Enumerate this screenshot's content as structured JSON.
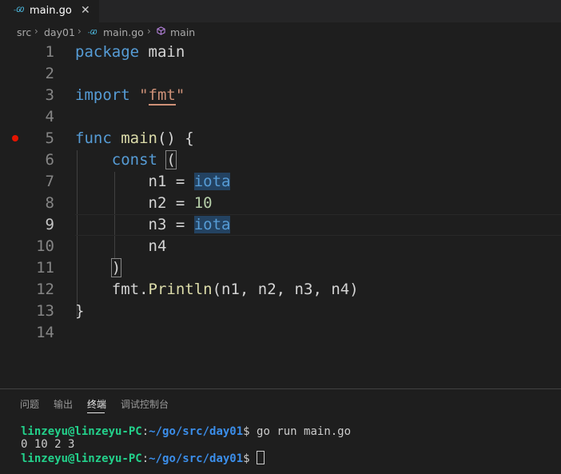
{
  "tab": {
    "icon": "go-file-icon",
    "filename": "main.go",
    "close_glyph": "✕"
  },
  "breadcrumb": {
    "items": [
      "src",
      "day01",
      "main.go",
      "main"
    ],
    "separator": "›"
  },
  "editor": {
    "line_numbers": [
      "1",
      "2",
      "3",
      "4",
      "5",
      "6",
      "7",
      "8",
      "9",
      "10",
      "11",
      "12",
      "13",
      "14"
    ],
    "active_line": "9",
    "breakpoint_line": "5",
    "tokens": {
      "l1_kw": "package",
      "l1_id": " main",
      "l3_kw": "import",
      "l3_q1": " \"",
      "l3_str": "fmt",
      "l3_q2": "\"",
      "l5_kw": "func",
      "l5_fn": " main",
      "l5_rest": "() {",
      "l6_indent": "    ",
      "l6_kw": "const",
      "l6_sp": " ",
      "l6_paren": "(",
      "l7_indent": "        ",
      "l7_id": "n1 = ",
      "l7_iota": "iota",
      "l8_indent": "        ",
      "l8_id": "n2 = ",
      "l8_num": "10",
      "l9_indent": "        ",
      "l9_id": "n3 = ",
      "l9_iota": "iota",
      "l10_indent": "        ",
      "l10_id": "n4",
      "l11_indent": "    ",
      "l11_paren": ")",
      "l12_indent": "    ",
      "l12_pkg": "fmt.",
      "l12_fn": "Println",
      "l12_args": "(n1, n2, n3, n4)",
      "l13_brace": "}"
    }
  },
  "panel": {
    "tabs": [
      "问题",
      "输出",
      "终端",
      "调试控制台"
    ],
    "active_tab": "终端",
    "terminal": {
      "user_host": "linzeyu@linzeyu-PC",
      "colon": ":",
      "path": "~/go/src/day01",
      "prompt": "$ ",
      "command": "go run main.go",
      "output": "0 10 2 3",
      "user_host2": "linzeyu@linzeyu-PC",
      "path2": "~/go/src/day01",
      "prompt2": "$ "
    }
  },
  "colors": {
    "keyword": "#569cd6",
    "function": "#dcdcaa",
    "string": "#ce9178",
    "number": "#b5cea8",
    "terminal_user": "#23d18b",
    "terminal_path": "#3b8eea",
    "breakpoint": "#e51400"
  }
}
